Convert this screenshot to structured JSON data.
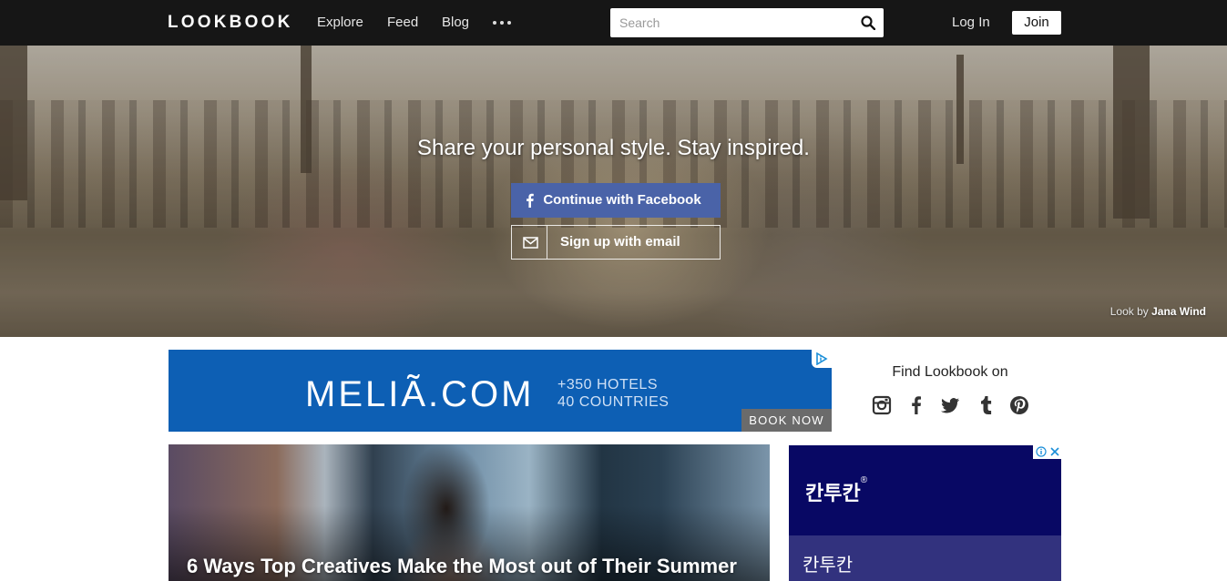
{
  "nav": {
    "logo": "LOOKBOOK",
    "links": [
      "Explore",
      "Feed",
      "Blog"
    ],
    "more_icon": "more-dots-icon",
    "search_placeholder": "Search",
    "login": "Log In",
    "join": "Join"
  },
  "hero": {
    "headline": "Share your personal style. Stay inspired.",
    "facebook_button": "Continue with Facebook",
    "email_button": "Sign up with email",
    "credit_prefix": "Look by",
    "credit_name": "Jana Wind"
  },
  "ad_banner": {
    "brand": "MELIÃ.COM",
    "line1": "+350 HOTELS",
    "line2": "40 COUNTRIES",
    "cta": "BOOK NOW"
  },
  "social": {
    "heading": "Find Lookbook on",
    "icons": [
      "instagram-icon",
      "facebook-icon",
      "twitter-icon",
      "tumblr-icon",
      "pinterest-icon"
    ]
  },
  "article": {
    "title": "6 Ways Top Creatives Make the Most out of Their Summer"
  },
  "side_ad": {
    "logo": "칸투칸",
    "logo_mark": "®",
    "label": "칸투칸"
  },
  "colors": {
    "nav_bg": "#161616",
    "facebook": "#4a63a8",
    "ad_banner_bg": "#0d5fb4",
    "side_ad_bg": "#080864"
  }
}
